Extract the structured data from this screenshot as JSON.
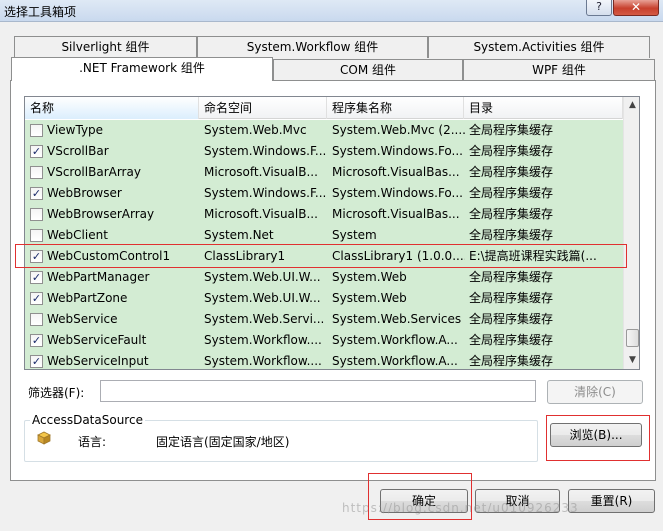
{
  "window": {
    "title": "选择工具箱项",
    "help_glyph": "?",
    "close_glyph": "✕"
  },
  "tabs_back": [
    "Silverlight 组件",
    "System.Workflow 组件",
    "System.Activities 组件"
  ],
  "tabs_front": [
    ".NET Framework 组件",
    "COM 组件",
    "WPF 组件"
  ],
  "list": {
    "columns": [
      "名称",
      "命名空间",
      "程序集名称",
      "目录"
    ],
    "rows": [
      {
        "checked": false,
        "name": "ViewType",
        "namespace": "System.Web.Mvc",
        "assembly": "System.Web.Mvc (2....",
        "directory": "全局程序集缓存"
      },
      {
        "checked": true,
        "name": "VScrollBar",
        "namespace": "System.Windows.F...",
        "assembly": "System.Windows.Fo...",
        "directory": "全局程序集缓存"
      },
      {
        "checked": false,
        "name": "VScrollBarArray",
        "namespace": "Microsoft.VisualB...",
        "assembly": "Microsoft.VisualBas...",
        "directory": "全局程序集缓存"
      },
      {
        "checked": true,
        "name": "WebBrowser",
        "namespace": "System.Windows.F...",
        "assembly": "System.Windows.Fo...",
        "directory": "全局程序集缓存"
      },
      {
        "checked": false,
        "name": "WebBrowserArray",
        "namespace": "Microsoft.VisualB...",
        "assembly": "Microsoft.VisualBas...",
        "directory": "全局程序集缓存"
      },
      {
        "checked": false,
        "name": "WebClient",
        "namespace": "System.Net",
        "assembly": "System",
        "directory": "全局程序集缓存"
      },
      {
        "checked": true,
        "name": "WebCustomControl1",
        "namespace": "ClassLibrary1",
        "assembly": "ClassLibrary1 (1.0.0....",
        "directory": "E:\\提高班课程实践篇(..."
      },
      {
        "checked": true,
        "name": "WebPartManager",
        "namespace": "System.Web.UI.W...",
        "assembly": "System.Web",
        "directory": "全局程序集缓存"
      },
      {
        "checked": true,
        "name": "WebPartZone",
        "namespace": "System.Web.UI.W...",
        "assembly": "System.Web",
        "directory": "全局程序集缓存"
      },
      {
        "checked": false,
        "name": "WebService",
        "namespace": "System.Web.Servi...",
        "assembly": "System.Web.Services",
        "directory": "全局程序集缓存"
      },
      {
        "checked": true,
        "name": "WebServiceFault",
        "namespace": "System.Workflow....",
        "assembly": "System.Workflow.A...",
        "directory": "全局程序集缓存"
      },
      {
        "checked": true,
        "name": "WebServiceInput",
        "namespace": "System.Workflow....",
        "assembly": "System.Workflow.A...",
        "directory": "全局程序集缓存"
      }
    ],
    "check_glyph": "✓"
  },
  "filter": {
    "label": "筛选器(F):",
    "value": "",
    "clear_label": "清除(C)"
  },
  "info": {
    "group_title": "AccessDataSource",
    "language_label": "语言:",
    "language_value": "固定语言(固定国家/地区)"
  },
  "buttons": {
    "browse": "浏览(B)...",
    "ok": "确定",
    "cancel": "取消",
    "reset": "重置(R)"
  },
  "watermark": "https://blog.csdn.net/u010926233"
}
